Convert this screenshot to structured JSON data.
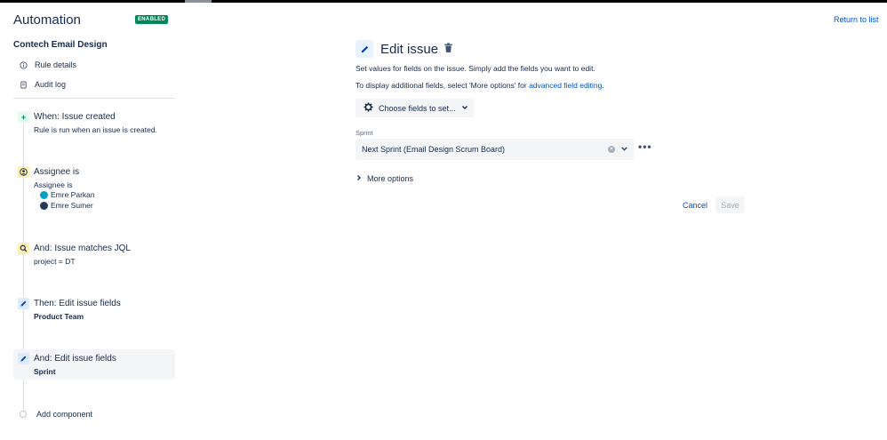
{
  "sidebar": {
    "app_title": "Automation",
    "status_badge": "ENABLED",
    "rule_name": "Contech Email Design",
    "nav": [
      {
        "label": "Rule details",
        "icon": "info-icon"
      },
      {
        "label": "Audit log",
        "icon": "document-icon"
      }
    ],
    "components": [
      {
        "title": "When: Issue created",
        "subtitle": "Rule is run when an issue is created.",
        "icon": "plus-icon"
      },
      {
        "title": "Assignee is",
        "subtitle": "Assignee is",
        "icon": "user-icon",
        "users": [
          {
            "name": "Emre Parkan"
          },
          {
            "name": "Emre Sumer"
          }
        ]
      },
      {
        "title": "And: Issue matches JQL",
        "subtitle": "project = DT",
        "icon": "search-icon"
      },
      {
        "title": "Then: Edit issue fields",
        "subtitle": "Product Team",
        "icon": "pencil-icon"
      },
      {
        "title": "And: Edit issue fields",
        "subtitle": "Sprint",
        "icon": "pencil-icon",
        "selected": true
      }
    ],
    "add_component": "Add component"
  },
  "main": {
    "return_link": "Return to list",
    "title": "Edit issue",
    "desc1": "Set values for fields on the issue. Simply add the fields you want to edit.",
    "desc2_prefix": "To display additional fields, select 'More options' for ",
    "desc2_link": "advanced field editing",
    "desc2_suffix": ".",
    "choose_fields": "Choose fields to set...",
    "field_label": "Sprint",
    "field_value": "Next Sprint (Email Design Scrum Board)",
    "more_options": "More options",
    "cancel": "Cancel",
    "save": "Save"
  },
  "colors": {
    "accent": "#0052cc",
    "badge": "#00875a",
    "when_icon_bg": "#e3fcef",
    "condition_icon_bg": "#fff0b3",
    "action_icon_bg": "#deebff"
  }
}
